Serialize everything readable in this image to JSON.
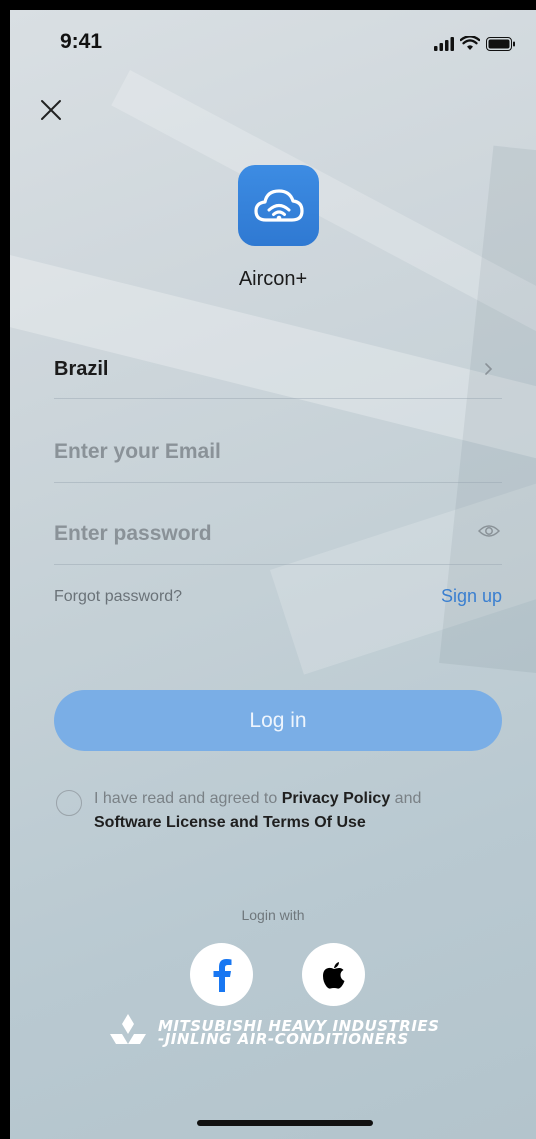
{
  "status_bar": {
    "time": "9:41"
  },
  "app": {
    "name": "Aircon+"
  },
  "country": {
    "value": "Brazil"
  },
  "email": {
    "placeholder": "Enter your Email"
  },
  "password": {
    "placeholder": "Enter password"
  },
  "links": {
    "forgot": "Forgot password?",
    "signup": "Sign up"
  },
  "login_button": {
    "label": "Log in"
  },
  "agreement": {
    "prefix": "I have read and agreed to",
    "privacy": "Privacy Policy",
    "and": "and",
    "terms": "Software License and Terms Of Use"
  },
  "social": {
    "label": "Login with",
    "facebook_icon": "facebook-icon",
    "apple_icon": "apple-icon"
  },
  "brand": {
    "line1": "MITSUBISHI HEAVY INDUSTRIES",
    "line2": "-JINLING AIR-CONDITIONERS"
  },
  "colors": {
    "accent": "#3a7fd0",
    "button": "#7aaee6",
    "app_icon": "#3d8ce3"
  }
}
